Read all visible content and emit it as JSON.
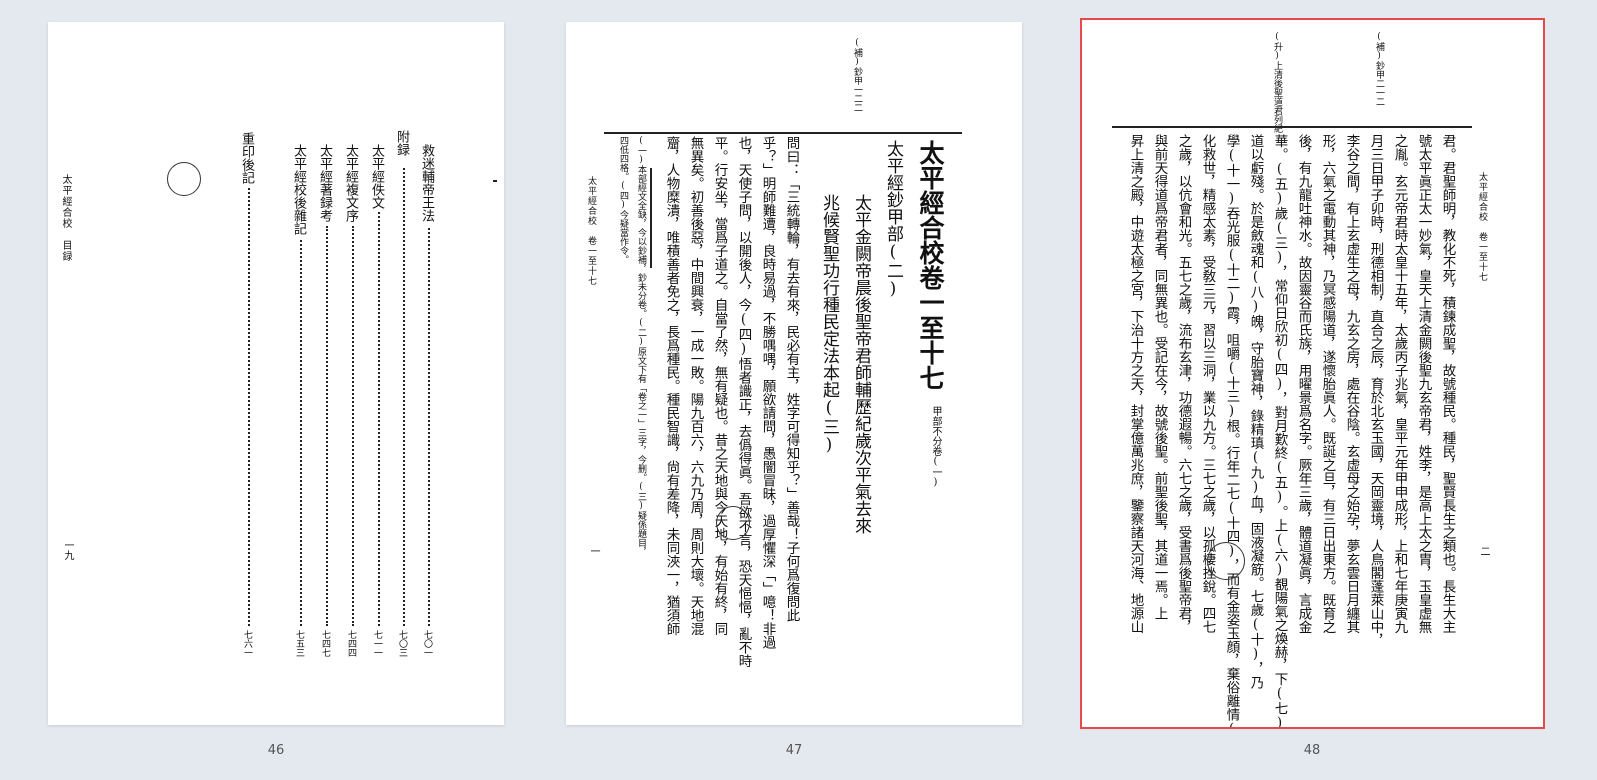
{
  "pages": [
    {
      "number": "46",
      "header": "太平經合校　目録",
      "footer_num": "一九",
      "toc": [
        {
          "title": "救迷輔帝王法",
          "page": "七〇一"
        },
        {
          "title": "附録",
          "page": "七〇三"
        },
        {
          "title": "太平經佚文",
          "page": "七一一"
        },
        {
          "title": "太平經複文序",
          "page": "七四四"
        },
        {
          "title": "太平經著録考",
          "page": "七四七"
        },
        {
          "title": "太平經校後雜記",
          "page": "七五三"
        },
        {
          "title": "重印後記",
          "page": "七六一"
        }
      ]
    },
    {
      "number": "47",
      "running_head": "太平經合校　卷一至十七",
      "page_mark": "一",
      "side_note": "(補)鈔甲一二二",
      "title": "太平經合校卷一至十七",
      "title_note": "甲部不分卷(一)",
      "subtitle": "太平經鈔甲部(二)",
      "heading_1": "太平金闕帝晨後聖帝君師輔歷紀歲次平氣去來",
      "heading_2": "兆候賢聖功行種民定法本起(三)",
      "body": [
        "問曰：「三統轉輪，有去有來，民必有主，姓字可得知乎？」善哉！子何爲復問此",
        "乎？」明師難遭，良時易過，不勝喁喁，願欲請問，愚闇冒昧，過厚懼深「」噫！非過",
        "也，天使子問，以開後人，今(四)悟者識正，去僞得眞。吾欲不言，恐天悒悒，亂不時",
        "平。行安坐，當爲子道之。自當了然，無有疑也。昔之天地與今天地，有始有終，同",
        "無異矣。初善後惡，中間興衰，一成一敗。陽九百六，六九乃周，周則大壞。天地混",
        "齏，人物糜潰，唯積善者免之，長爲種民。種民智識，尙有差降，未同浹一，猶須師"
      ],
      "notes": [
        "(一)本部經文全缺，今以鈔補，鈔未分卷。(二)原文下有「卷之一」三字，今删。(三)疑係題目，",
        "四低四格。(四)今疑當作令。"
      ]
    },
    {
      "number": "48",
      "running_head": "太平經合校　卷一至十七",
      "page_mark": "二",
      "side_note_1": "(補)鈔甲二一二",
      "side_note_2": "(升)上清後聖道君列紀",
      "body": [
        "君。君聖師明，教化不死，積鍊成聖，故號種民。種民，聖賢長生之類也。長生大主",
        "號太平眞正太一妙氣，皇天上清金闕後聖九玄帝君，姓李，是高上太之胄，玉皇虚無",
        "之胤。玄元帝君時太皇十五年，太歲丙子兆氣，皇平元年甲申成形，上和七年庚寅九",
        "月三日甲子卯時，刑德相制，直合之辰，育於北玄玉國，天岡靈境，人鳥閣蓬萊山中，",
        "李谷之間，有上玄虚生之母，九玄之房，處在谷陰。玄虚母之始孕，夢玄雲日月纏其",
        "形，六氣之電動其神，乃冥感陽道，遂懷胎眞人。既誕之旦，有三日出東方。既育之",
        "後，有九龍吐神水。故因靈谷而氏族，用曜景爲名字。厥年三歲，體道凝眞，言成金",
        "華。(五)歲(三)，常仰日欣初(四)，對月歎終(五)。上(六)覩陽氣之煥赫，下(七)覩陰",
        "道以虧殘。於是斂魂和(八)魄，守胎寶神，錄精瑱(九)血，固液凝筋。七歲(十)，乃",
        "學(十一)吞光服(十二)霞，咀嚼(十三)根。行年二七(十四)，而有金姿玉顔，棄俗離情(十五)，擢",
        "化救世，精感太素，受敎三元，習以三洞，業以九方。三七之歲，以孤棲挫銳。四七",
        "之歲，以伉會和光。五七之歲，流布玄津，功德遐暢。六七之歲，受書爲後聖帝君，",
        "與前天得道爲帝君者，同無異也。受記在今，故號後聖。前聖後聖，其道一焉。上",
        "昇上清之殿，中遊太極之宮，下治十方之天，封掌億萬兆庶，鑒察諸天河海、地源山"
      ]
    }
  ]
}
